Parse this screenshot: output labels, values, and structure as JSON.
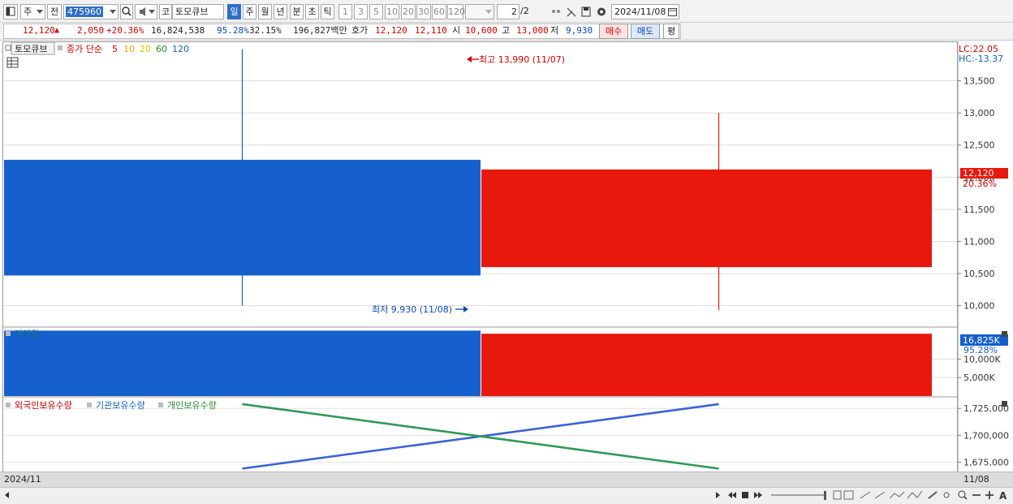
{
  "toolbar": {
    "market": "주",
    "adj": "전",
    "code": "475960",
    "exchange_tag": "코",
    "stock_name": "토모큐브",
    "periods": [
      "일",
      "주",
      "월",
      "년",
      "분",
      "초",
      "틱"
    ],
    "active_period": "일",
    "intervals": [
      "1",
      "3",
      "5",
      "10",
      "20",
      "30",
      "60",
      "120"
    ],
    "page_current": "2",
    "page_total": "/2",
    "date": "2024/11/08"
  },
  "quote": {
    "price": "12,120",
    "change": "2,050",
    "change_pct": "+20.36%",
    "volume": "16,824,538",
    "vol_ratio": "95.28%",
    "turnover": "32.15%",
    "amount": "196,827백만",
    "hoga_label": "호가",
    "ask": "12,120",
    "bid": "12,110",
    "open_label": "시",
    "open": "10,600",
    "high_label": "고",
    "high": "13,000",
    "low_label": "저",
    "low": "9,930",
    "buy_label": "매수",
    "sell_label": "매도",
    "avg_label": "평"
  },
  "price_panel": {
    "stock_name": "토모큐브",
    "ma_title": "종가 단순",
    "ma_periods": [
      "5",
      "10",
      "20",
      "60",
      "120"
    ],
    "ma_colors": [
      "#d10000",
      "#e8a800",
      "#d8c800",
      "#2a8a2a",
      "#1a5fb4"
    ],
    "lc_label": "LC:22.05",
    "hc_label": "HC:-13.37",
    "last_price_tag": "12,120",
    "last_pct_tag": "20.36%",
    "high_annotation": "최고 13,990 (11/07)",
    "low_annotation": "최저 9,930 (11/08)"
  },
  "volume_panel": {
    "title": "거래량",
    "last_tag": "16,825K",
    "ratio_tag": "95.28%"
  },
  "holdings_panel": {
    "titles": [
      "외국인보유수량",
      "기관보유수량",
      "개인보유수량"
    ],
    "title_colors": [
      "#c00000",
      "#1a5fb4",
      "#2a8a2a"
    ]
  },
  "date_bar": {
    "left": "2024/11",
    "right": "11/08"
  },
  "chart_data": [
    {
      "type": "candlestick",
      "dates": [
        "11/07",
        "11/08"
      ],
      "open": [
        10470,
        10600
      ],
      "high": [
        13990,
        13000
      ],
      "low": [
        10000,
        9930
      ],
      "close": [
        12270,
        12120
      ],
      "colors": [
        "#1560cc",
        "#e8180c"
      ],
      "y_ticks": [
        10000,
        10500,
        11000,
        11500,
        12000,
        12500,
        13000,
        13500
      ],
      "y_tick_labels": [
        "10,000",
        "10,500",
        "11,000",
        "11,500",
        "12,000",
        "12,500",
        "13,000",
        "13,500"
      ],
      "ylim": [
        9680,
        14100
      ],
      "grid": true
    },
    {
      "type": "bar",
      "categories": [
        "11/07",
        "11/08"
      ],
      "values": [
        17660,
        16825
      ],
      "colors": [
        "#1560cc",
        "#e8180c"
      ],
      "y_ticks": [
        5000,
        10000
      ],
      "y_tick_labels": [
        "5,000K",
        "10,000K"
      ],
      "ylim": [
        0,
        18400
      ],
      "grid": true
    },
    {
      "type": "line",
      "categories": [
        "11/07",
        "11/08"
      ],
      "series": [
        {
          "name": "기관보유수량",
          "color": "#3a62d8",
          "values": [
            1669000,
            1729000
          ]
        },
        {
          "name": "개인보유수량",
          "color": "#2e9a55",
          "values": [
            1729000,
            1669000
          ]
        }
      ],
      "y_ticks": [
        1675000,
        1700000,
        1725000
      ],
      "y_tick_labels": [
        "1,675,000",
        "1,700,000",
        "1,725,000"
      ],
      "ylim": [
        1667000,
        1735000
      ],
      "grid": true
    }
  ]
}
